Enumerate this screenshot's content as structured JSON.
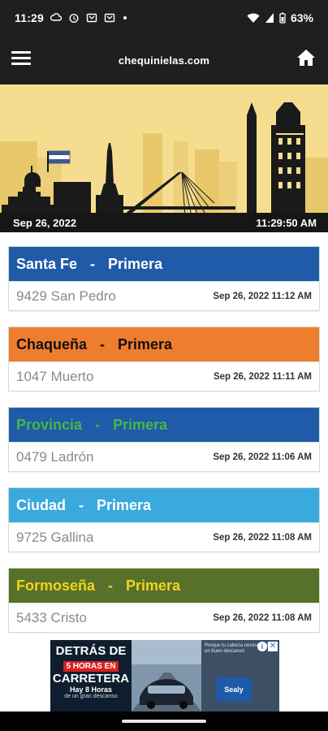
{
  "status_bar": {
    "time": "11:29",
    "battery": "63%",
    "icons": [
      "cloud-sync-icon",
      "alarm-icon",
      "cast-icon",
      "cast-icon",
      "dot-icon",
      "wifi-icon",
      "signal-icon",
      "battery-icon"
    ]
  },
  "app_bar": {
    "title": "chequinielas.com",
    "menu_icon": "hamburger-menu-icon",
    "home_icon": "home-icon"
  },
  "banner": {
    "date": "Sep 26, 2022",
    "time": "11:29:50 AM",
    "background": "#f5dd8f"
  },
  "results": [
    {
      "province": "Santa Fe",
      "separator": "-",
      "draw": "Primera",
      "number": "9429 San Pedro",
      "timestamp": "Sep 26, 2022 11:12 AM",
      "header_bg": "#1f5ba8",
      "header_color": "#ffffff",
      "draw_color": "#ffffff"
    },
    {
      "province": "Chaqueña",
      "separator": "-",
      "draw": "Primera",
      "number": "1047 Muerto",
      "timestamp": "Sep 26, 2022 11:11 AM",
      "header_bg": "#ef7d2e",
      "header_color": "#111111",
      "draw_color": "#111111"
    },
    {
      "province": "Provincia",
      "separator": "-",
      "draw": "Primera",
      "number": "0479 Ladrón",
      "timestamp": "Sep 26, 2022 11:06 AM",
      "header_bg": "#1f5ba8",
      "header_color": "#47b549",
      "draw_color": "#47b549"
    },
    {
      "province": "Ciudad",
      "separator": "-",
      "draw": "Primera",
      "number": "9725 Gallina",
      "timestamp": "Sep 26, 2022 11:08 AM",
      "header_bg": "#3aa9dd",
      "header_color": "#ffffff",
      "draw_color": "#ffffff"
    },
    {
      "province": "Formoseña",
      "separator": "-",
      "draw": "Primera",
      "number": "5433 Cristo",
      "timestamp": "Sep 26, 2022 11:08 AM",
      "header_bg": "#57712a",
      "header_color": "#f2d21b",
      "draw_color": "#f2d21b"
    }
  ],
  "ad": {
    "line1": "DETRÁS DE",
    "line2": "5 HORAS EN",
    "line3": "CARRETERA",
    "line4": "Hay 8 Horas",
    "line5": "de un gran descanso",
    "side_text": "Porque tu cabeza necesita de un buen descanso",
    "brand": "Sealy",
    "close": "✕",
    "info": "i"
  }
}
